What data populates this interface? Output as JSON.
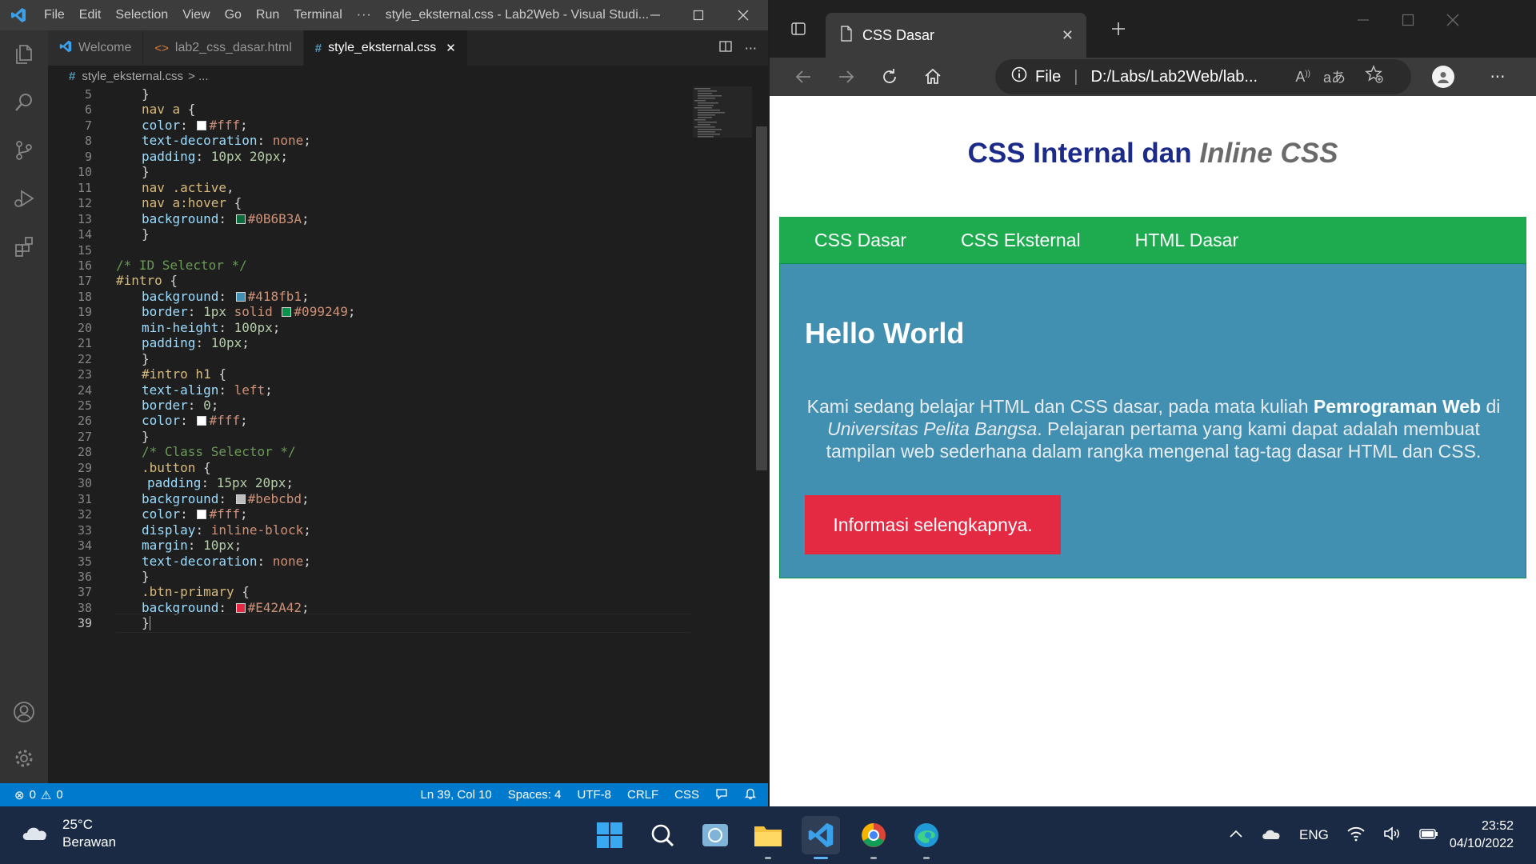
{
  "vscode": {
    "menu": [
      "File",
      "Edit",
      "Selection",
      "View",
      "Go",
      "Run",
      "Terminal",
      "···"
    ],
    "window_title": "style_eksternal.css - Lab2Web - Visual Studi...",
    "tabs": [
      {
        "label": "Welcome",
        "icon": "vscode-icon"
      },
      {
        "label": "lab2_css_dasar.html",
        "icon": "html-icon"
      },
      {
        "label": "style_eksternal.css",
        "icon": "css-icon"
      }
    ],
    "breadcrumb": {
      "file": "style_eksternal.css",
      "rest": "> ..."
    },
    "status": {
      "errors": "0",
      "warnings": "0",
      "position": "Ln 39, Col 10",
      "spaces": "Spaces: 4",
      "encoding": "UTF-8",
      "eol": "CRLF",
      "language": "CSS"
    },
    "code_lines": [
      {
        "n": "5",
        "text": "}"
      },
      {
        "n": "6",
        "text": "nav a {"
      },
      {
        "n": "7",
        "text": "color:  #fff;"
      },
      {
        "n": "8",
        "text": "text-decoration: none;"
      },
      {
        "n": "9",
        "text": "padding:10px 20px;"
      },
      {
        "n": "10",
        "text": "}"
      },
      {
        "n": "11",
        "text": "nav .active,"
      },
      {
        "n": "12",
        "text": "nav a:hover {"
      },
      {
        "n": "13",
        "text": "background:  #0B6B3A;"
      },
      {
        "n": "14",
        "text": "}"
      },
      {
        "n": "15",
        "text": ""
      },
      {
        "n": "16",
        "text": "/* ID Selector */"
      },
      {
        "n": "17",
        "text": "#intro {"
      },
      {
        "n": "18",
        "text": "background:  #418fb1;"
      },
      {
        "n": "19",
        "text": "border: 1px solid  #099249;"
      },
      {
        "n": "20",
        "text": "min-height: 100px;"
      },
      {
        "n": "21",
        "text": "padding: 10px;"
      },
      {
        "n": "22",
        "text": "}"
      },
      {
        "n": "23",
        "text": "#intro h1 {"
      },
      {
        "n": "24",
        "text": "text-align: left;"
      },
      {
        "n": "25",
        "text": "border: 0;"
      },
      {
        "n": "26",
        "text": "color:  #fff;"
      },
      {
        "n": "27",
        "text": "}"
      },
      {
        "n": "28",
        "text": "/* Class Selector */"
      },
      {
        "n": "29",
        "text": ".button {"
      },
      {
        "n": "30",
        "text": "padding: 15px 20px;"
      },
      {
        "n": "31",
        "text": "background:  #bebcbd;"
      },
      {
        "n": "32",
        "text": "color:  #fff;"
      },
      {
        "n": "33",
        "text": "display: inline-block;"
      },
      {
        "n": "34",
        "text": "margin: 10px;"
      },
      {
        "n": "35",
        "text": "text-decoration: none;"
      },
      {
        "n": "36",
        "text": "}"
      },
      {
        "n": "37",
        "text": ".btn-primary {"
      },
      {
        "n": "38",
        "text": "background:  #E42A42;"
      },
      {
        "n": "39",
        "text": "}"
      }
    ],
    "colors": {
      "swatch_fff": "#ffffff",
      "swatch_0b6b3a": "#0B6B3A",
      "swatch_418fb1": "#418fb1",
      "swatch_099249": "#099249",
      "swatch_bebcbd": "#bebcbd",
      "swatch_e42a42": "#E42A42"
    }
  },
  "edge": {
    "tab_title": "CSS Dasar",
    "address_scheme": "File",
    "address": "D:/Labs/Lab2Web/lab...",
    "page": {
      "title_main": "CSS Internal dan ",
      "title_em": "Inline CSS",
      "nav": [
        "CSS Dasar",
        "CSS Eksternal",
        "HTML Dasar"
      ],
      "heading": "Hello World",
      "para_1": "Kami sedang belajar HTML dan CSS dasar, pada mata kuliah ",
      "para_bold": "Pemrograman Web",
      "para_2": " di ",
      "para_italic": "Universitas Pelita Bangsa",
      "para_3": ". Pelajaran pertama yang kami dapat adalah membuat tampilan web sederhana dalam rangka mengenal tag-tag dasar HTML dan CSS.",
      "button": "Informasi selengkapnya."
    }
  },
  "taskbar": {
    "weather_temp": "25°C",
    "weather_desc": "Berawan",
    "language": "ENG",
    "time": "23:52",
    "date": "04/10/2022"
  }
}
